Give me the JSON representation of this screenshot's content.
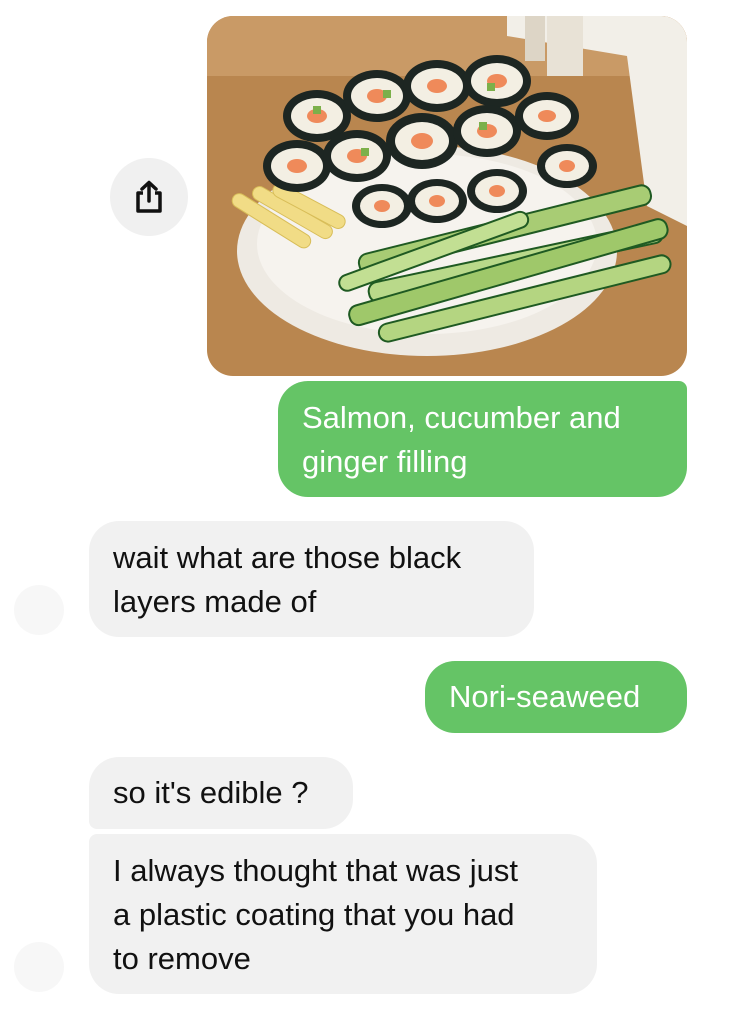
{
  "thread": {
    "share_icon": "share-icon",
    "photo": {
      "subject": "sushi-plate-photo"
    },
    "messages": [
      {
        "from": "me",
        "text": "Salmon, cucumber and\nginger filling"
      },
      {
        "from": "them",
        "text": "wait what are those black\nlayers made of"
      },
      {
        "from": "me",
        "text": "Nori-seaweed"
      },
      {
        "from": "them",
        "text": "so it's edible ?"
      },
      {
        "from": "them",
        "text": "I always thought that was just\na plastic coating that you had\nto remove"
      }
    ]
  },
  "colors": {
    "outgoing_bubble": "#65c466",
    "incoming_bubble": "#f1f1f1",
    "share_button_bg": "#f0f0f0"
  }
}
